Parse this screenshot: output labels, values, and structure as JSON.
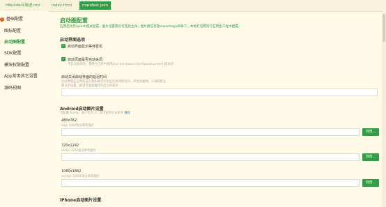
{
  "tabs": [
    {
      "label": "HBuilderX简述.md"
    },
    {
      "label": "index.html"
    },
    {
      "label": "manifest.json"
    }
  ],
  "sidebar": {
    "items": [
      {
        "label": "基础配置",
        "warning": "!"
      },
      {
        "label": "图标配置"
      },
      {
        "label": "启动图配置"
      },
      {
        "label": "SDK配置"
      },
      {
        "label": "模块权限配置"
      },
      {
        "label": "App常用其它设置"
      },
      {
        "label": "源码视图"
      }
    ]
  },
  "main": {
    "title": "启动图配置",
    "desc": "应用启动页splash相关配置。图片设置需云打包后生效，图片建议存放unpackage目录下，本地打包需另行在原生工程中配置。",
    "startup": {
      "heading": "启动界面选项",
      "check1": {
        "label": "启动界面显示等待雪花",
        "mark": "✓"
      },
      "check2": {
        "label": "启动页面是否自动关闭",
        "mark": "✓",
        "sub": "不自动关闭时，需要在应用中调用plus.navigator.closeSplashscreen()来关闭"
      },
      "delay": {
        "label": "启动关闭启动界面的延迟时间",
        "hint1": "启动界面在应用的首页面加载完毕后延迟关闭的时间，单位为毫秒，么就是默认",
        "hint2": "默认不设置，即首页面加载完毕后立即关闭",
        "value": ""
      }
    },
    "android": {
      "heading": "Android启动图片设置",
      "hint": "可配置.9.png，减少包大小，具体使用方法参考",
      "hint_link": "教程",
      "items": [
        {
          "size": "480x762",
          "hint": "hdpi 480P高分辨率图片",
          "browse": "浏览..."
        },
        {
          "size": "720x1242",
          "hint": "xhdpi 720P高分辨率图片",
          "browse": "浏览..."
        },
        {
          "size": "1080x1882",
          "hint": "xxhdpi 1080P高分辨率图片",
          "browse": "浏览..."
        }
      ]
    },
    "ios": {
      "heading": "iPhone启动图片设置"
    }
  },
  "colors": {
    "accent": "#2f9e44",
    "background": "#fffbe6"
  }
}
